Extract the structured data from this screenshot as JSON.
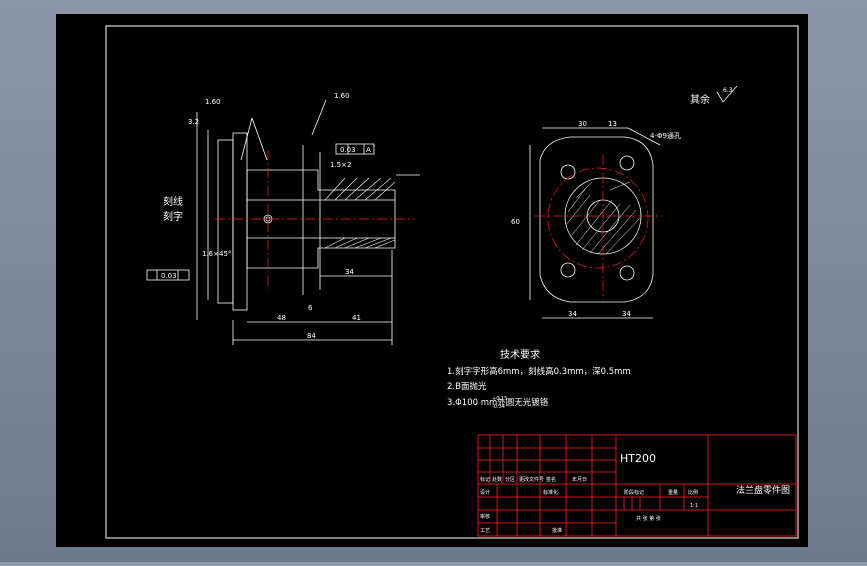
{
  "colors": {
    "outer_bg": "#7b8798",
    "canvas": "#000000",
    "border": "#ffffff",
    "hatch": "#ffffff",
    "table_red": "#ff2020",
    "centerline": "#ff2020",
    "dim": "#ffffff"
  },
  "drawing": {
    "roughness_mark": "其余",
    "roughness_value": "6.3",
    "left_view": {
      "labels": [
        "刻线",
        "刻字"
      ],
      "dims": {
        "top_left": "1.60",
        "top_right": "1.60",
        "ra": "3.2",
        "tol1": "0.03",
        "datum": "A",
        "len_48": "48",
        "len_41": "41",
        "len_84": "84",
        "len_34": "34",
        "len_6": "6",
        "chamfer": "1.6×45°",
        "c2": "1.5×2",
        "left_perp": "0.03"
      }
    },
    "right_view": {
      "dims": {
        "w30": "30",
        "w13": "13",
        "holes": "4-Φ9通孔",
        "w34a": "34",
        "w34b": "34",
        "h60": "60"
      }
    },
    "tech_req": {
      "title": "技术要求",
      "line1": "1.刻字字形高6mm，刻线高0.3mm，深0.5mm",
      "line2": "2.B面抛光",
      "line3": "3.Φ100  mm外圆无光镀铬",
      "line3_sup": "+0.15",
      "line3_sub": "-0.34"
    }
  },
  "title_block": {
    "material": "HT200",
    "part_name": "法兰盘零件图",
    "cells": {
      "mark": "标记",
      "count": "处数",
      "zone": "分区",
      "change_doc": "更改文件号",
      "signature": "签名",
      "date": "年月日",
      "design": "设计",
      "standard": "标准化",
      "stage_mark": "阶段标记",
      "weight": "重量",
      "scale": "比例",
      "scale_value": "1:1",
      "review": "审核",
      "process": "工艺",
      "approve": "批准",
      "sheet": "共 张 第 张"
    }
  }
}
